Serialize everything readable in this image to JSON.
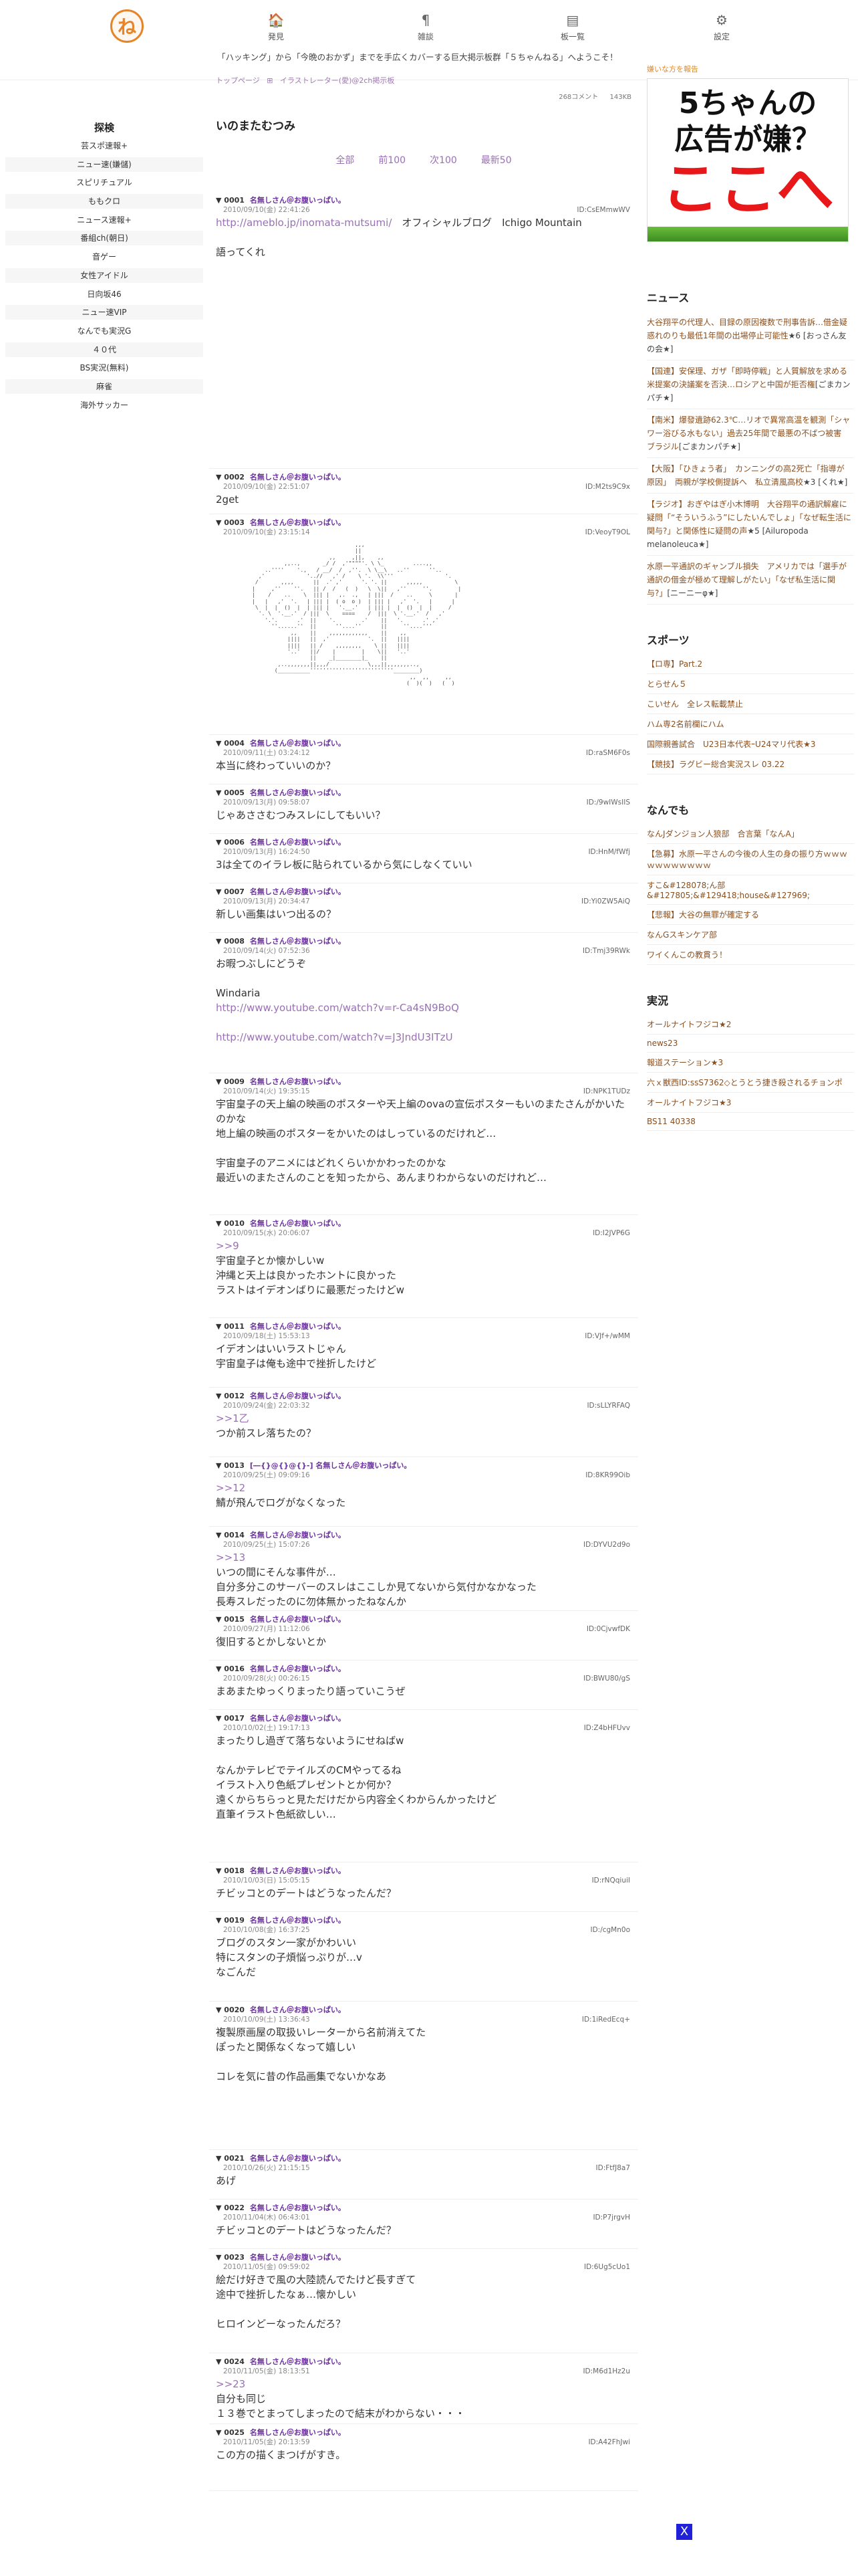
{
  "header": {
    "logo_text": "ね",
    "nav": [
      {
        "icon": "🏠",
        "label": "発見"
      },
      {
        "icon": "¶",
        "label": "雑談"
      },
      {
        "icon": "▤",
        "label": "板一覧"
      },
      {
        "icon": "⚙",
        "label": "設定"
      }
    ],
    "marquee": "「ハッキング」から「今晩のおかず」までを手広くカバーする巨大掲示板群「５ちゃんねる」へようこそ！"
  },
  "left_sidebar": {
    "title": "探検",
    "items": [
      "芸スポ速報+",
      "ニュー速(嫌儲)",
      "スピリチュアル",
      "ももクロ",
      "ニュース速報+",
      "番組ch(朝日)",
      "音ゲー",
      "女性アイドル",
      "日向坂46",
      "ニュー速VIP",
      "なんでも実況G",
      "４０代",
      "BS実況(無料)",
      "麻雀",
      "海外サッカー"
    ]
  },
  "breadcrumb": [
    "トップページ",
    "⊞",
    "イラストレーター(愛)@2ch掲示板"
  ],
  "meta": {
    "comments": "268コメント",
    "size": "143KB"
  },
  "thread_title": "いのまたむつみ",
  "pager": [
    "全部",
    "前100",
    "次100",
    "最新50"
  ],
  "posts": [
    {
      "num": "▼ 0001",
      "name": "名無しさん＠お腹いっぱい。",
      "date": "2010/09/10(金) 22:41:26",
      "id": "ID:CsEMmwWV",
      "body": "",
      "link": "http://ameblo.jp/inomata-mutsumi/",
      "link_after": "　オフィシャルブログ　Ichigo Mountain\n\n語ってくれ"
    },
    {
      "num": "▼ 0002",
      "name": "名無しさん＠お腹いっぱい。",
      "date": "2010/09/10(金) 22:51:07",
      "id": "ID:M2ts9C9x",
      "body": "2get"
    },
    {
      "num": "▼ 0003",
      "name": "名無しさん＠お腹いっぱい。",
      "date": "2010/09/10(金) 23:15:14",
      "id": "ID:VeoyT9OL",
      "body": ""
    },
    {
      "num": "▼ 0004",
      "name": "名無しさん＠お腹いっぱい。",
      "date": "2010/09/11(土) 03:24:12",
      "id": "ID:raSM6F0s",
      "body": "本当に終わっていいのか？"
    },
    {
      "num": "▼ 0005",
      "name": "名無しさん＠お腹いっぱい。",
      "date": "2010/09/13(月) 09:58:07",
      "id": "ID:/9wIWsIIS",
      "body": "じゃあささむつみスレにしてもいい？"
    },
    {
      "num": "▼ 0006",
      "name": "名無しさん＠お腹いっぱい。",
      "date": "2010/09/13(月) 16:24:50",
      "id": "ID:HnM/fWfj",
      "body": "3は全てのイラレ板に貼られているから気にしなくていい"
    },
    {
      "num": "▼ 0007",
      "name": "名無しさん＠お腹いっぱい。",
      "date": "2010/09/13(月) 20:34:47",
      "id": "ID:Yi0ZW5AiQ",
      "body": "新しい画集はいつ出るの？"
    },
    {
      "num": "▼ 0008",
      "name": "名無しさん＠お腹いっぱい。",
      "date": "2010/09/14(火) 07:52:36",
      "id": "ID:Tmj39RWk",
      "body": "お暇つぶしにどうぞ\n\nWindaria",
      "link": "http://www.youtube.com/watch?v=r-Ca4sN9BoQ",
      "link2": "http://www.youtube.com/watch?v=J3JndU3ITzU"
    },
    {
      "num": "▼ 0009",
      "name": "名無しさん＠お腹いっぱい。",
      "date": "2010/09/14(火) 19:35:15",
      "id": "ID:NPK1TUDz",
      "body": "宇宙皇子の天上編の映画のポスターや天上編のovaの宣伝ポスターもいのまたさんがかいたのかな\n地上編の映画のポスターをかいたのはしっているのだけれど…\n\n宇宙皇子のアニメにはどれくらいかかわったのかな\n最近いのまたさんのことを知ったから、あんまりわからないのだけれど…"
    },
    {
      "num": "▼ 0010",
      "name": "名無しさん＠お腹いっぱい。",
      "date": "2010/09/15(水) 20:06:07",
      "id": "ID:I2JVP6G",
      "reply": ">>9",
      "body": "宇宙皇子とか懐かしいw\n沖縄と天上は良かったホントに良かった\nラストはイデオンばりに最悪だったけどw"
    },
    {
      "num": "▼ 0011",
      "name": "名無しさん＠お腹いっぱい。",
      "date": "2010/09/18(土) 15:53:13",
      "id": "ID:VJf+/wMM",
      "body": "イデオンはいいラストじゃん\n宇宙皇子は俺も途中で挫折したけど"
    },
    {
      "num": "▼ 0012",
      "name": "名無しさん＠お腹いっぱい。",
      "date": "2010/09/24(金) 22:03:32",
      "id": "ID:sLLYRFAQ",
      "reply": ">>1乙",
      "body": "つか前スレ落ちたの？"
    },
    {
      "num": "▼ 0013",
      "name": "[―{}@{}@{}-] 名無しさん＠お腹いっぱい。",
      "date": "2010/09/25(土) 09:09:16",
      "id": "ID:8KR99Oib",
      "reply": ">>12",
      "body": "鯖が飛んでログがなくなった"
    },
    {
      "num": "▼ 0014",
      "name": "名無しさん＠お腹いっぱい。",
      "date": "2010/09/25(土) 15:07:26",
      "id": "ID:DYVU2d9o",
      "reply": ">>13",
      "body": "いつの間にそんな事件が…\n自分多分このサーバーのスレはここしか見てないから気付かなかなった\n長寿スレだったのに勿体無かったねなんか"
    },
    {
      "num": "▼ 0015",
      "name": "名無しさん＠お腹いっぱい。",
      "date": "2010/09/27(月) 11:12:06",
      "id": "ID:0CjvwfDK",
      "body": "復旧するとかしないとか"
    },
    {
      "num": "▼ 0016",
      "name": "名無しさん＠お腹いっぱい。",
      "date": "2010/09/28(火) 00:26:15",
      "id": "ID:BWU80/gS",
      "body": "まあまたゆっくりまったり語っていこうぜ"
    },
    {
      "num": "▼ 0017",
      "name": "名無しさん＠お腹いっぱい。",
      "date": "2010/10/02(土) 19:17:13",
      "id": "ID:Z4bHFUvv",
      "body": "まったりし過ぎて落ちないようにせねばw\n\nなんかテレビでテイルズのCMやってるね\nイラスト入り色紙プレゼントとか何か？\n遠くからちらっと見ただけだから内容全くわからんかったけど\n直筆イラスト色紙欲しい…"
    },
    {
      "num": "▼ 0018",
      "name": "名無しさん＠お腹いっぱい。",
      "date": "2010/10/03(日) 15:05:15",
      "id": "ID:rNQqiuiI",
      "body": "チビッコとのデートはどうなったんだ？"
    },
    {
      "num": "▼ 0019",
      "name": "名無しさん＠お腹いっぱい。",
      "date": "2010/10/08(金) 16:37:25",
      "id": "ID:/cgMn0o",
      "body": "ブログのスタン一家がかわいい\n特にスタンの子煩悩っぷりが…v\nなごんだ"
    },
    {
      "num": "▼ 0020",
      "name": "名無しさん＠お腹いっぱい。",
      "date": "2010/10/09(土) 13:36:43",
      "id": "ID:1iRedEcq+",
      "body": "複製原画屋の取扱いレーターから名前消えてた\nぽったと関係なくなって嬉しい\n\nコレを気に昔の作品画集でないかなあ"
    },
    {
      "num": "▼ 0021",
      "name": "名無しさん＠お腹いっぱい。",
      "date": "2010/10/26(火) 21:15:15",
      "id": "ID:FtfJ8a7",
      "body": "あげ"
    },
    {
      "num": "▼ 0022",
      "name": "名無しさん＠お腹いっぱい。",
      "date": "2010/11/04(木) 06:43:01",
      "id": "ID:P7jrgvH",
      "body": "チビッコとのデートはどうなったんだ？"
    },
    {
      "num": "▼ 0023",
      "name": "名無しさん＠お腹いっぱい。",
      "date": "2010/11/05(金) 09:59:02",
      "id": "ID:6Ug5cUo1",
      "body": "絵だけ好きで風の大陸読んでたけど長すぎて\n途中で挫折したなぁ…懐かしい\n\nヒロインどーなったんだろ？"
    },
    {
      "num": "▼ 0024",
      "name": "名無しさん＠お腹いっぱい。",
      "date": "2010/11/05(金) 18:13:51",
      "id": "ID:M6d1Hz2u",
      "reply": ">>23",
      "body": "自分も同じ\n１３巻でとまってしまったので結末がわからない・・・"
    },
    {
      "num": "▼ 0025",
      "name": "名無しさん＠お腹いっぱい。",
      "date": "2010/11/05(金) 20:13:59",
      "id": "ID:A42FhJwi",
      "body": "この方の描くまつげがすき。"
    }
  ],
  "right_sidebar": {
    "ad_label": "嫌いな方を報告",
    "ad_line1": "5ちゃんの\n広告が嫌？",
    "ad_line2": "ここへ",
    "news_title": "ニュース",
    "news": [
      {
        "text": "大谷翔平の代理人、目録の原因複数で刑事告訴…借金疑惑れのりも最低1年間の出場停止可能性",
        "src": "★6 [おっさん友の会★]"
      },
      {
        "text": "【国連】安保理、ガザ「即時停戦」と人質解放を求める米提案の決議案を否決…ロシアと中国が拒否権",
        "src": "[ごまカンパチ★]"
      },
      {
        "text": "【南米】爆發遺跡62.3℃…リオで異常高温を観測「シャワー浴びる水もない」過去25年間で最悪の不ばつ被害　ブラジル",
        "src": "[ごまカンパチ★]"
      },
      {
        "text": "【大阪】「ひきょう者」　カンニングの高2死亡「指導が原因」　両親が学校側提訴へ　私立清風高校",
        "src": "★3 [くれ★]"
      },
      {
        "text": "【ラジオ】おぎやはぎ小木博明　大谷翔平の通訳解雇に疑問「“そういうふう”にしたいんでしょ」「なぜ転生活に関与?」と関係性に疑問の声",
        "src": "★5 [Ailuropoda melanoleuca★]"
      },
      {
        "text": "水原一平通訳のギャンブル損失　アメリカでは「選手が通訳の借金が極めて理解しがたい」「なぜ私生活に関与?」",
        "src": "[ニーニーφ★]"
      }
    ],
    "sports_title": "スポーツ",
    "sports": [
      "【ロ専】Part.2",
      "とらせん５",
      "こいせん　全レス転載禁止",
      "ハム専2名前欄にハム",
      "国際親善試合　U23日本代表ｰU24マリ代表★3",
      "【競技】ラグビー総合実況スレ 03.22"
    ],
    "nandemo_title": "なんでも",
    "nandemo": [
      "なんJダンジョン人狼部　合言葉「なんA」",
      "【急募】水原一平さんの今後の人生の身の振り方ｗｗｗｗｗｗｗｗｗｗｗ",
      "すこ&#128078;ん部&#127805;&#129418;house&#127969;",
      "【悲報】大谷の無罪が確定する",
      "なんGスキンケア部",
      "ワイくんこの教貫う！"
    ],
    "jikkyo_title": "実況",
    "jikkyo": [
      "オールナイトフジコ★2",
      "news23",
      "報道ステーション★3",
      "六ｘ獣西ID:ssS7362◇とうとう捷き殺されるチョンポ",
      "オールナイトフジコ★3",
      "BS11 40338"
    ]
  },
  "bottom_badge": "X"
}
